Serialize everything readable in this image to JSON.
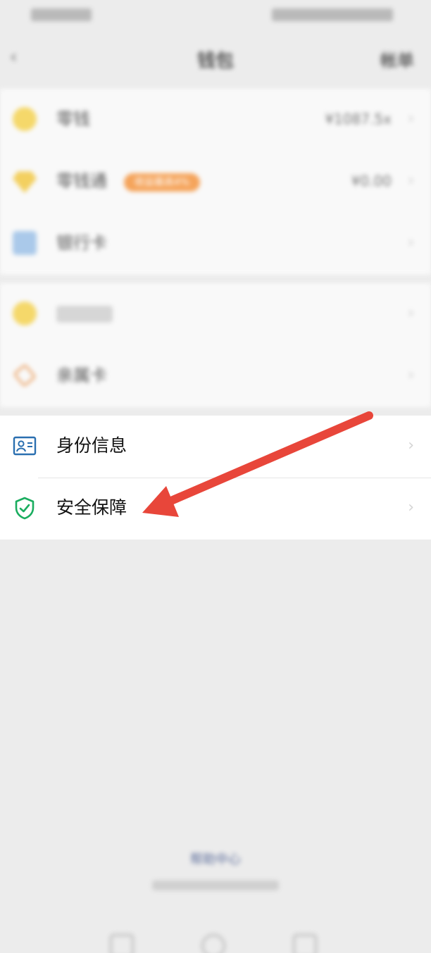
{
  "status_bar": {},
  "nav": {
    "back_glyph": "‹",
    "title": "钱包",
    "action": "帐单"
  },
  "group1": [
    {
      "label": "零钱",
      "value": "¥1087.5x",
      "icon": "coin-icon"
    },
    {
      "label": "零钱通",
      "value": "¥0.00",
      "badge": "收益最高4%",
      "icon": "gem-icon"
    },
    {
      "label": "银行卡",
      "value": "",
      "icon": "bank-card-icon"
    }
  ],
  "group2": [
    {
      "label": "亲属卡",
      "icon": "family-card-icon"
    }
  ],
  "group3": [
    {
      "label": "身份信息",
      "icon": "id-card-icon"
    },
    {
      "label": "安全保障",
      "icon": "shield-check-icon"
    }
  ],
  "chevron": "›",
  "footer": {
    "link": "帮助中心"
  },
  "colors": {
    "arrow": "#e8463a",
    "shield": "#1aad5f",
    "id_icon": "#2a6fb0"
  }
}
